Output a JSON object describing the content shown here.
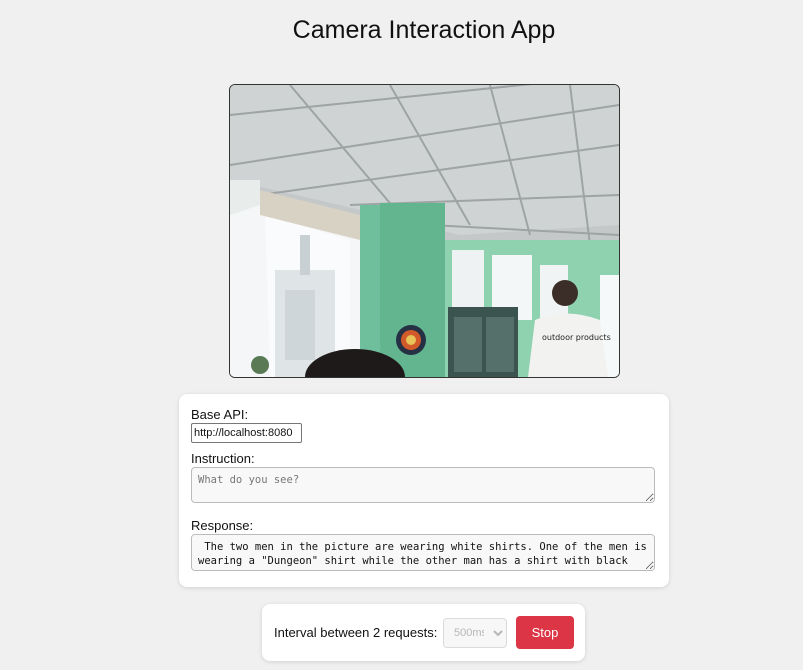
{
  "page": {
    "title": "Camera Interaction App"
  },
  "form": {
    "base_api_label": "Base API:",
    "base_api_value": "http://localhost:8080",
    "instruction_label": "Instruction:",
    "instruction_placeholder": "What do you see?",
    "response_label": "Response:",
    "response_text": " The two men in the picture are wearing white shirts. One of the men is wearing a \"Dungeon\" shirt while the other man has a shirt with black letters"
  },
  "controls": {
    "interval_label": "Interval between 2 requests:",
    "interval_selected": "500ms",
    "stop_label": "Stop",
    "stop_color": "#dc3545"
  },
  "video_feed": {
    "shirt_text": "outdoor products"
  }
}
